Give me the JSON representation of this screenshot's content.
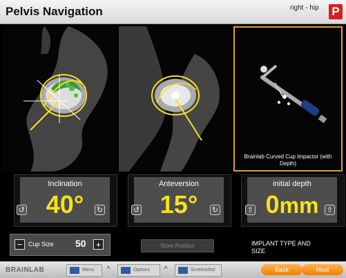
{
  "header": {
    "title": "Pelvis Navigation",
    "side": "right - hip",
    "logo": "P"
  },
  "instrument": {
    "label": "Brainlab Curved Cup Impactor (with Depth)"
  },
  "cards": {
    "inclination": {
      "label": "Inclination",
      "value": "40",
      "unit": "°"
    },
    "anteversion": {
      "label": "Anteversion",
      "value": "15",
      "unit": "°"
    },
    "depth": {
      "label": "initial depth",
      "value": "0",
      "unit": "mm"
    }
  },
  "cup": {
    "label": "Cup Size",
    "value": "50",
    "minus": "−",
    "plus": "+"
  },
  "store_label": "Store Position",
  "implant_text": "IMPLANT TYPE AND SIZE",
  "footer": {
    "brand": "BRAINLAB",
    "menu": "Menu",
    "options": "Options",
    "screenshot": "Screenshot",
    "back": "Back",
    "next": "Next"
  },
  "icons": {
    "rotate_left": "↺",
    "rotate_right": "↻",
    "arrow_up": "⇧"
  },
  "colors": {
    "accent": "#f7e11a",
    "highlight": "#e0a020",
    "button": "#f07f00",
    "logo": "#d42020"
  }
}
